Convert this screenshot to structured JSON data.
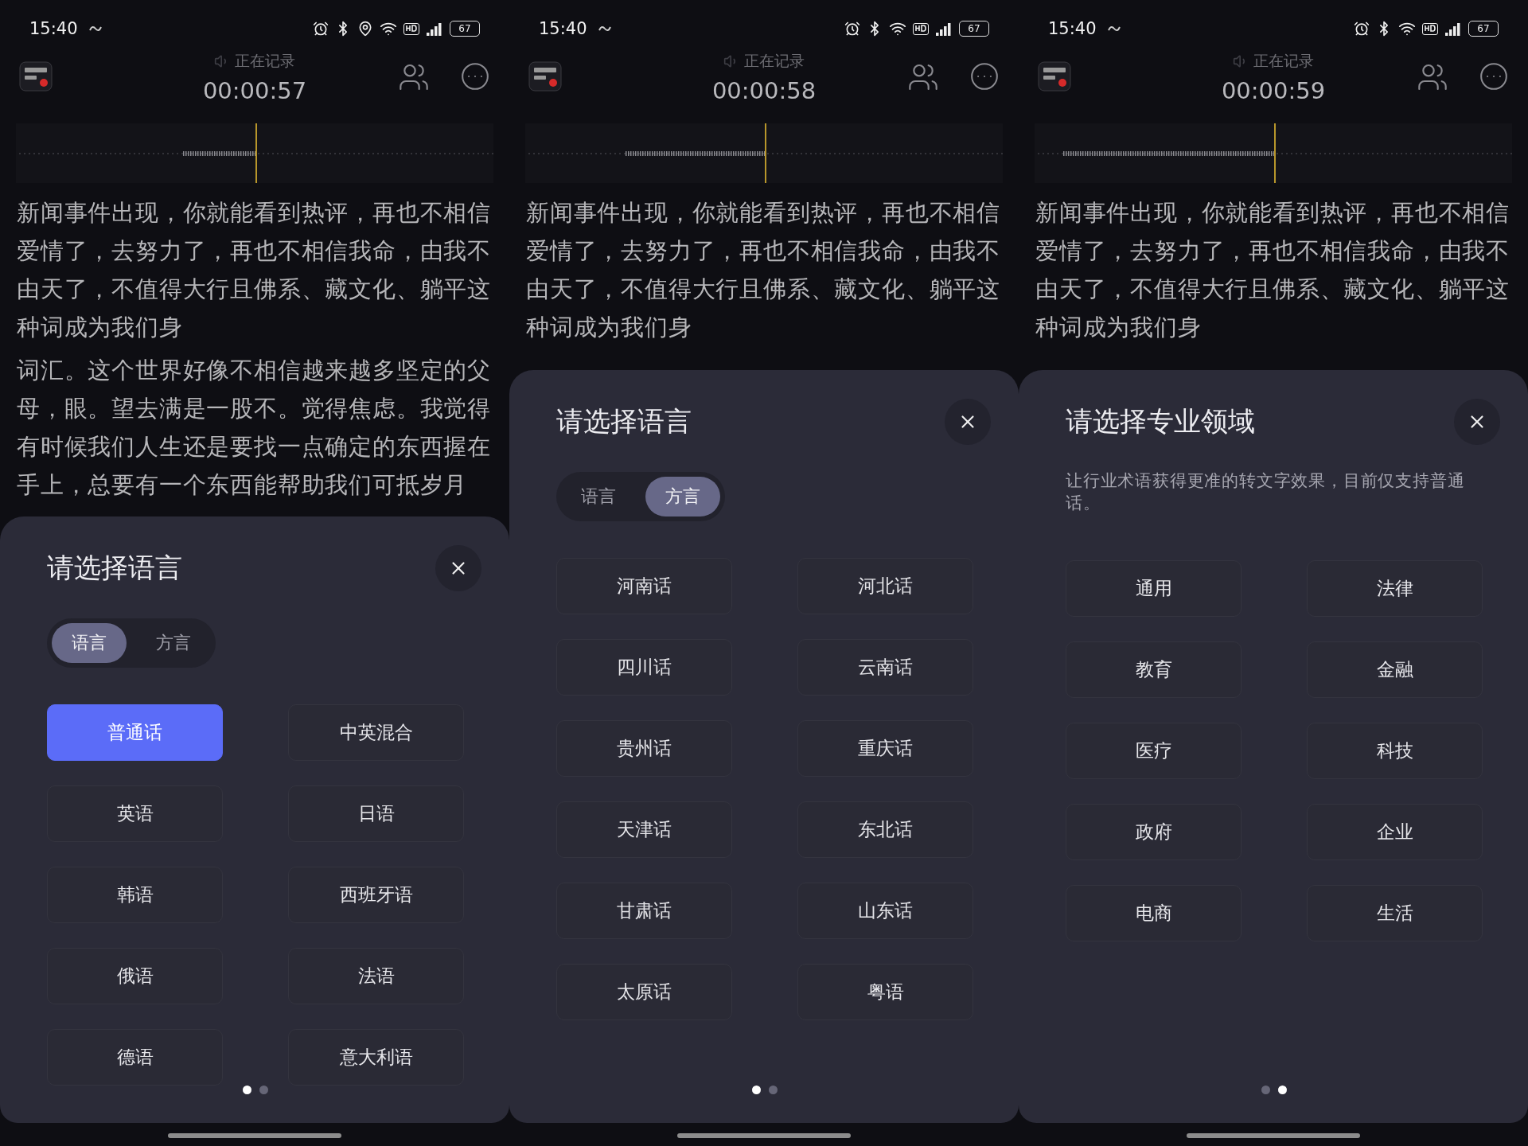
{
  "phones": [
    {
      "status_bar": {
        "time": "15:40",
        "battery": "67",
        "location": true
      },
      "header": {
        "label": "正在记录",
        "timer": "00:00:57"
      },
      "transcript": [
        "新闻事件出现，你就能看到热评，再也不相信爱情了，去努力了，再也不相信我命，由我不由天了，不值得大行且佛系、藏文化、躺平这种词成为我们身",
        "词汇。这个世界好像不相信越来越多坚定的父母，眼。望去满是一股不。觉得焦虑。我觉得有时候我们人生还是要找一点确定的东西握在手上，总要有一个东西能帮助我们可抵岁月"
      ],
      "sheet": {
        "title": "请选择语言",
        "tabs": [
          {
            "label": "语言",
            "selected": true
          },
          {
            "label": "方言",
            "selected": false
          }
        ],
        "options": [
          {
            "label": "普通话",
            "selected": true
          },
          {
            "label": "中英混合",
            "selected": false
          },
          {
            "label": "英语",
            "selected": false
          },
          {
            "label": "日语",
            "selected": false
          },
          {
            "label": "韩语",
            "selected": false
          },
          {
            "label": "西班牙语",
            "selected": false
          },
          {
            "label": "俄语",
            "selected": false
          },
          {
            "label": "法语",
            "selected": false
          },
          {
            "label": "德语",
            "selected": false
          },
          {
            "label": "意大利语",
            "selected": false
          }
        ],
        "pages": [
          {
            "selected": true
          },
          {
            "selected": false
          }
        ]
      }
    },
    {
      "status_bar": {
        "time": "15:40",
        "battery": "67",
        "location": false
      },
      "header": {
        "label": "正在记录",
        "timer": "00:00:58"
      },
      "transcript": [
        "新闻事件出现，你就能看到热评，再也不相信爱情了，去努力了，再也不相信我命，由我不由天了，不值得大行且佛系、藏文化、躺平这种词成为我们身"
      ],
      "sheet": {
        "title": "请选择语言",
        "tabs": [
          {
            "label": "语言",
            "selected": false
          },
          {
            "label": "方言",
            "selected": true
          }
        ],
        "options": [
          {
            "label": "河南话",
            "selected": false
          },
          {
            "label": "河北话",
            "selected": false
          },
          {
            "label": "四川话",
            "selected": false
          },
          {
            "label": "云南话",
            "selected": false
          },
          {
            "label": "贵州话",
            "selected": false
          },
          {
            "label": "重庆话",
            "selected": false
          },
          {
            "label": "天津话",
            "selected": false
          },
          {
            "label": "东北话",
            "selected": false
          },
          {
            "label": "甘肃话",
            "selected": false
          },
          {
            "label": "山东话",
            "selected": false
          },
          {
            "label": "太原话",
            "selected": false
          },
          {
            "label": "粤语",
            "selected": false
          }
        ],
        "pages": [
          {
            "selected": true
          },
          {
            "selected": false
          }
        ]
      }
    },
    {
      "status_bar": {
        "time": "15:40",
        "battery": "67",
        "location": false
      },
      "header": {
        "label": "正在记录",
        "timer": "00:00:59"
      },
      "transcript": [
        "新闻事件出现，你就能看到热评，再也不相信爱情了，去努力了，再也不相信我命，由我不由天了，不值得大行且佛系、藏文化、躺平这种词成为我们身"
      ],
      "sheet": {
        "title": "请选择专业领域",
        "description": "让行业术语获得更准的转文字效果，目前仅支持普通话。",
        "options": [
          {
            "label": "通用",
            "selected": false
          },
          {
            "label": "法律",
            "selected": false
          },
          {
            "label": "教育",
            "selected": false
          },
          {
            "label": "金融",
            "selected": false
          },
          {
            "label": "医疗",
            "selected": false
          },
          {
            "label": "科技",
            "selected": false
          },
          {
            "label": "政府",
            "selected": false
          },
          {
            "label": "企业",
            "selected": false
          },
          {
            "label": "电商",
            "selected": false
          },
          {
            "label": "生活",
            "selected": false
          }
        ],
        "pages": [
          {
            "selected": false
          },
          {
            "selected": true
          }
        ]
      }
    }
  ]
}
